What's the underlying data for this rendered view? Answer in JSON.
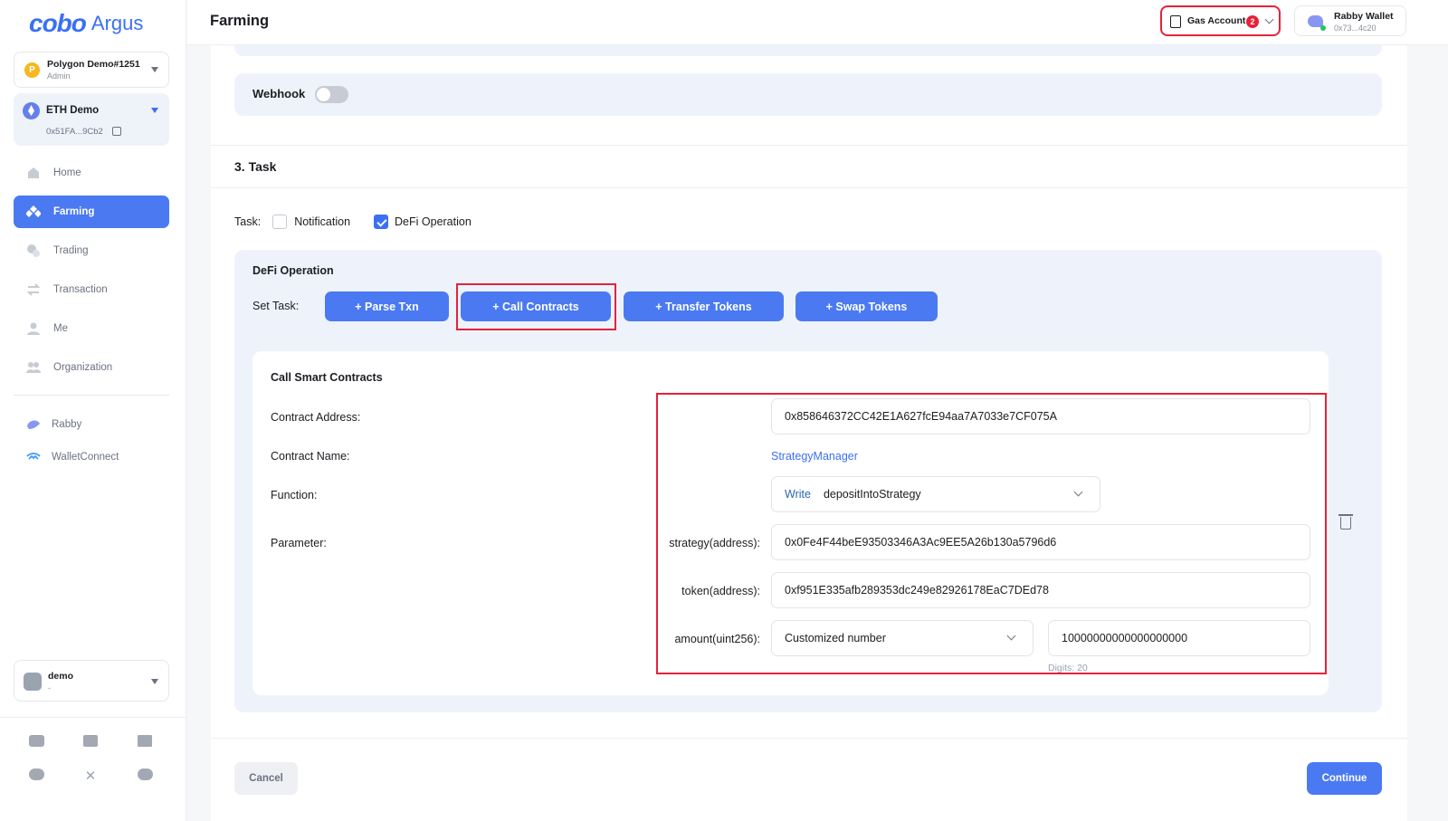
{
  "brand": {
    "logo_text": "cobo",
    "product": "Argus"
  },
  "sidebar": {
    "org": {
      "badge": "P",
      "name": "Polygon Demo#1251",
      "role": "Admin"
    },
    "wallet": {
      "name": "ETH Demo",
      "address": "0x51FA...9Cb2"
    },
    "nav": [
      {
        "label": "Home",
        "icon": "home-icon"
      },
      {
        "label": "Farming",
        "icon": "farming-icon"
      },
      {
        "label": "Trading",
        "icon": "trading-icon"
      },
      {
        "label": "Transaction",
        "icon": "transaction-icon"
      },
      {
        "label": "Me",
        "icon": "user-icon"
      },
      {
        "label": "Organization",
        "icon": "organization-icon"
      }
    ],
    "active_nav": "Farming",
    "connectors": [
      {
        "label": "Rabby",
        "icon": "rabby-icon"
      },
      {
        "label": "WalletConnect",
        "icon": "walletconnect-icon"
      }
    ],
    "user": {
      "name": "demo",
      "sub": "-"
    }
  },
  "header": {
    "title": "Farming",
    "gas_account": {
      "label": "Gas Account",
      "count": "2"
    },
    "rabby": {
      "name": "Rabby Wallet",
      "address": "0x73...4c20"
    }
  },
  "webhook": {
    "label": "Webhook",
    "enabled": false
  },
  "section": {
    "title": "3. Task"
  },
  "task": {
    "label": "Task:",
    "options": [
      {
        "label": "Notification",
        "checked": false
      },
      {
        "label": "DeFi Operation",
        "checked": true
      }
    ]
  },
  "defi": {
    "title": "DeFi Operation",
    "set_task_label": "Set Task:",
    "buttons": [
      "+ Parse Txn",
      "+ Call Contracts",
      "+ Transfer Tokens",
      "+ Swap Tokens"
    ]
  },
  "call": {
    "title": "Call Smart Contracts",
    "contract_address_label": "Contract Address:",
    "contract_address": "0x858646372CC42E1A627fcE94aa7A7033e7CF075A",
    "contract_name_label": "Contract Name:",
    "contract_name": "StrategyManager",
    "function_label": "Function:",
    "function_mode": "Write",
    "function_name": "depositIntoStrategy",
    "parameter_label": "Parameter:",
    "params": [
      {
        "label": "strategy(address):",
        "value": "0x0Fe4F44beE93503346A3Ac9EE5A26b130a5796d6"
      },
      {
        "label": "token(address):",
        "value": "0xf951E335afb289353dc249e82926178EaC7DEd78"
      }
    ],
    "amount_label": "amount(uint256):",
    "amount_type": "Customized number",
    "amount_value": "10000000000000000000",
    "digits": "Digits: 20"
  },
  "footer": {
    "cancel": "Cancel",
    "continue": "Continue"
  },
  "colors": {
    "accent": "#4a79f2",
    "highlight": "#e5223a",
    "panel": "#eef3fb"
  }
}
